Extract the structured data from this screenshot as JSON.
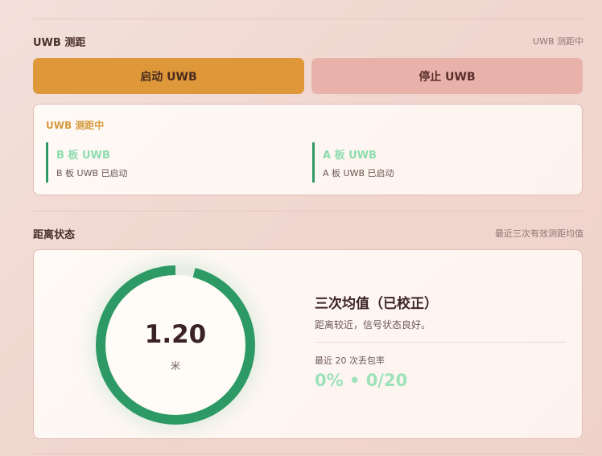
{
  "uwb_section": {
    "title": "UWB 测距",
    "status_text": "UWB 测距中",
    "start_button": "启动 UWB",
    "stop_button": "停止 UWB",
    "status_card": {
      "title": "UWB 测距中",
      "boards": [
        {
          "name": "B 板 UWB",
          "desc": "B 板 UWB 已启动"
        },
        {
          "name": "A 板 UWB",
          "desc": "A 板 UWB 已启动"
        }
      ]
    }
  },
  "distance_section": {
    "title": "距离状态",
    "meta": "最近三次有效测距均值",
    "gauge": {
      "value": "1.20",
      "unit": "米",
      "fill_fraction": 0.96
    },
    "info_title": "三次均值（已校正）",
    "info_desc": "距离较近，信号状态良好。",
    "loss_label": "最近 20 次丢包率",
    "loss_value": "0% • 0/20"
  },
  "colors": {
    "accent_orange": "#de9839",
    "stop_pink": "#e8b2aa",
    "gauge_green": "#2d9a66",
    "light_green_text": "#9de2b9"
  }
}
